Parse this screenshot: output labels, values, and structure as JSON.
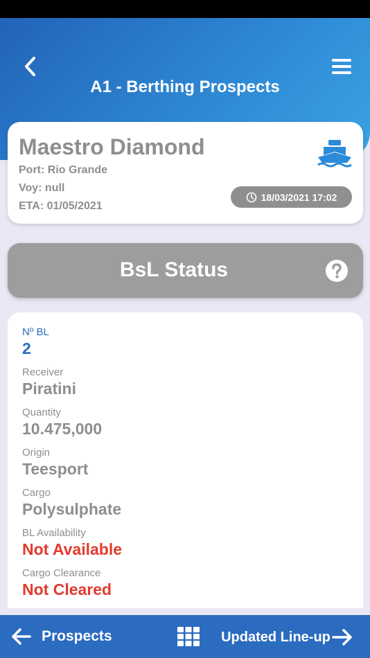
{
  "header": {
    "title": "A1 - Berthing Prospects"
  },
  "vessel": {
    "name": "Maestro Diamond",
    "port": "Port: Rio Grande",
    "voy": "Voy: null",
    "eta": "ETA: 01/05/2021",
    "timestamp": "18/03/2021 17:02",
    "icon": "ship-icon"
  },
  "status_panel": {
    "title": "BsL Status",
    "help_icon": "question-circle-icon"
  },
  "fields": [
    {
      "label": "Nº BL",
      "value": "2"
    },
    {
      "label": "Receiver",
      "value": "Piratini"
    },
    {
      "label": "Quantity",
      "value": "10.475,000"
    },
    {
      "label": "Origin",
      "value": "Teesport"
    },
    {
      "label": "Cargo",
      "value": "Polysulphate"
    },
    {
      "label": "BL Availability",
      "value": "Not Available"
    },
    {
      "label": "Cargo Clearance",
      "value": "Not Cleared"
    }
  ],
  "bottom_nav": {
    "left_label": "Prospects",
    "right_label": "Updated Line-up"
  },
  "colors": {
    "primary": "#2b6cc0",
    "alert": "#e43a2e",
    "muted": "#8e8e8e"
  }
}
